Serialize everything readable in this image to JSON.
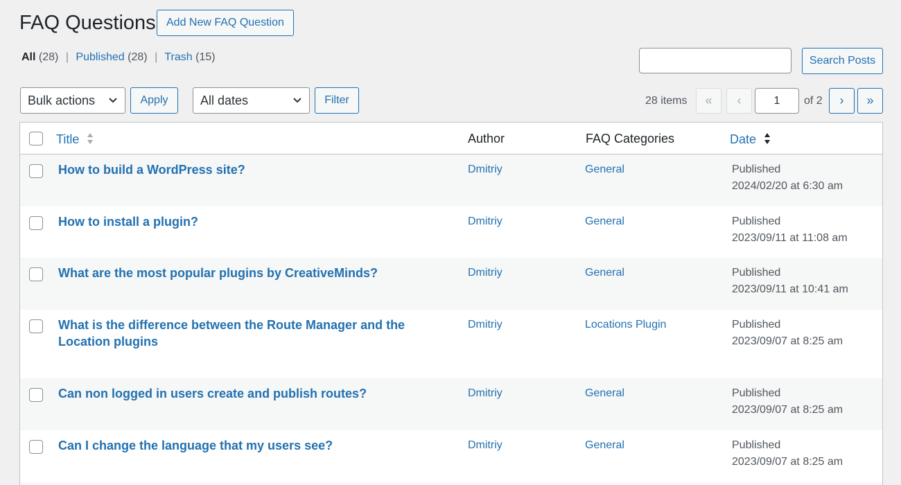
{
  "header": {
    "title": "FAQ Questions",
    "add_new_label": "Add New FAQ Question"
  },
  "views": {
    "all_label": "All",
    "all_count": "(28)",
    "published_label": "Published",
    "published_count": "(28)",
    "trash_label": "Trash",
    "trash_count": "(15)",
    "separator": "|"
  },
  "search": {
    "value": "",
    "button_label": "Search Posts"
  },
  "toolbar": {
    "bulk_actions_label": "Bulk actions",
    "apply_label": "Apply",
    "dates_label": "All dates",
    "filter_label": "Filter"
  },
  "pagination": {
    "items_count": "28 items",
    "first": "«",
    "prev": "‹",
    "current_page": "1",
    "of_label": "of 2",
    "next": "›",
    "last": "»"
  },
  "table": {
    "columns": {
      "title": "Title",
      "author": "Author",
      "categories": "FAQ Categories",
      "date": "Date"
    },
    "rows": [
      {
        "title": "How to build a WordPress site?",
        "author": "Dmitriy",
        "category": "General",
        "status": "Published",
        "date": "2024/02/20 at 6:30 am"
      },
      {
        "title": "How to install a plugin?",
        "author": "Dmitriy",
        "category": "General",
        "status": "Published",
        "date": "2023/09/11 at 11:08 am"
      },
      {
        "title": "What are the most popular plugins by CreativeMinds?",
        "author": "Dmitriy",
        "category": "General",
        "status": "Published",
        "date": "2023/09/11 at 10:41 am"
      },
      {
        "title": "What is the difference between the Route Manager and the Location plugins",
        "author": "Dmitriy",
        "category": "Locations Plugin",
        "status": "Published",
        "date": "2023/09/07 at 8:25 am"
      },
      {
        "title": "Can non logged in users create and publish routes?",
        "author": "Dmitriy",
        "category": "General",
        "status": "Published",
        "date": "2023/09/07 at 8:25 am"
      },
      {
        "title": "Can I change the language that my users see?",
        "author": "Dmitriy",
        "category": "General",
        "status": "Published",
        "date": "2023/09/07 at 8:25 am"
      }
    ]
  },
  "icons": {
    "sort_both": "sort-arrows-icon",
    "sort_desc": "sort-desc-icon",
    "chevron": "chevron-down-icon"
  }
}
